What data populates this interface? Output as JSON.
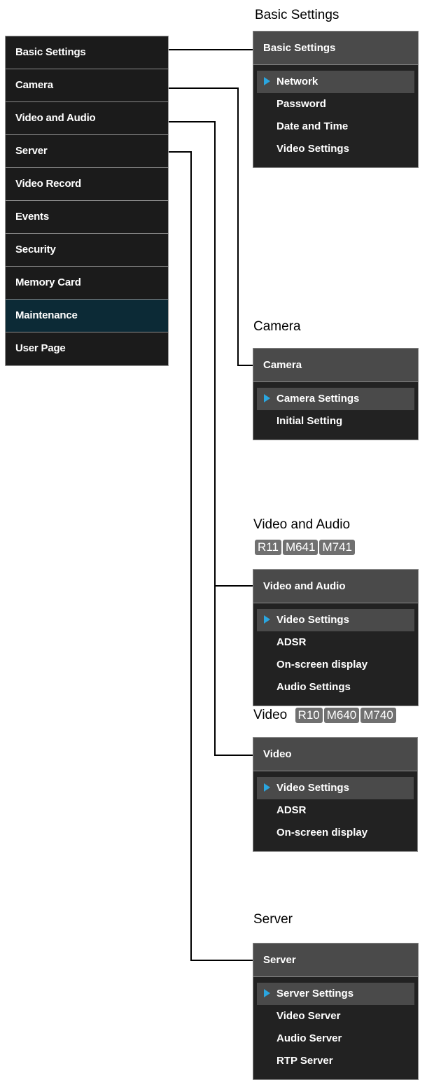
{
  "main_menu": {
    "items": [
      {
        "label": "Basic Settings"
      },
      {
        "label": "Camera"
      },
      {
        "label": "Video and Audio"
      },
      {
        "label": "Server"
      },
      {
        "label": "Video Record"
      },
      {
        "label": "Events"
      },
      {
        "label": "Security"
      },
      {
        "label": "Memory Card"
      },
      {
        "label": "Maintenance"
      },
      {
        "label": "User Page"
      }
    ]
  },
  "basic_settings": {
    "title": "Basic Settings",
    "header": "Basic Settings",
    "items": [
      "Network",
      "Password",
      "Date and Time",
      "Video Settings"
    ]
  },
  "camera": {
    "title": "Camera",
    "header": "Camera",
    "items": [
      "Camera Settings",
      "Initial Setting"
    ]
  },
  "video_audio": {
    "title": "Video and Audio",
    "models": [
      "R11",
      "M641",
      "M741"
    ],
    "header": "Video and Audio",
    "items": [
      "Video Settings",
      "ADSR",
      "On-screen display",
      "Audio Settings"
    ]
  },
  "video": {
    "title": "Video",
    "models": [
      "R10",
      "M640",
      "M740"
    ],
    "header": "Video",
    "items": [
      "Video Settings",
      "ADSR",
      "On-screen display"
    ]
  },
  "server": {
    "title": "Server",
    "header": "Server",
    "items": [
      "Server Settings",
      "Video Server",
      "Audio Server",
      "RTP Server"
    ]
  },
  "colors": {
    "menu_bg": "#1b1b1b",
    "active_bg": "#0c2a36",
    "header_bg": "#4a4a4a",
    "arrow": "#2aa6e0",
    "badge_bg": "#707070"
  }
}
